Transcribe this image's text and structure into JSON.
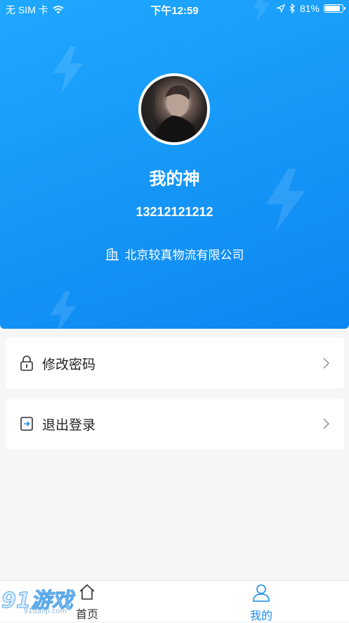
{
  "status_bar": {
    "carrier": "无 SIM 卡",
    "time": "下午12:59",
    "battery": "81%",
    "battery_level": 0.81
  },
  "profile": {
    "name": "我的神",
    "phone": "13212121212",
    "company": "北京较真物流有限公司"
  },
  "menu": {
    "change_password": "修改密码",
    "logout": "退出登录"
  },
  "tabbar": {
    "home_label": "首页",
    "mine_label": "我的"
  },
  "watermark": {
    "logo": "91游戏",
    "site": "91danji.com"
  },
  "colors": {
    "header_gradient_start": "#1fa8ff",
    "header_gradient_end": "#0b86f2",
    "active_tab": "#1a8ff0",
    "inactive_tab": "#333333"
  }
}
